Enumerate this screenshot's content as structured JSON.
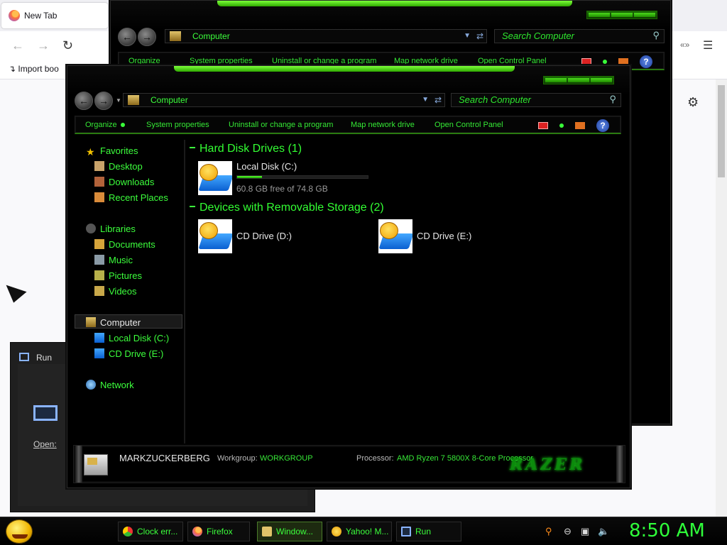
{
  "firefox": {
    "tab_title": "New Tab",
    "import_bookmarks": "Import boo",
    "ext_label": "«»"
  },
  "run_dialog": {
    "title": "Run",
    "open_label": "Open:"
  },
  "explorer_back": {
    "address": "Computer",
    "search_placeholder": "Search Computer",
    "commands": [
      "Organize",
      "System properties",
      "Uninstall or change a program",
      "Map network drive",
      "Open Control Panel"
    ]
  },
  "explorer": {
    "address": "Computer",
    "search_placeholder": "Search Computer",
    "commands": {
      "organize": "Organize",
      "system_properties": "System properties",
      "uninstall": "Uninstall or change a program",
      "map_drive": "Map network drive",
      "control_panel": "Open Control Panel"
    },
    "nav": {
      "favorites": "Favorites",
      "desktop": "Desktop",
      "downloads": "Downloads",
      "recent": "Recent Places",
      "libraries": "Libraries",
      "documents": "Documents",
      "music": "Music",
      "pictures": "Pictures",
      "videos": "Videos",
      "computer": "Computer",
      "local_disk": "Local Disk (C:)",
      "cd_drive": "CD Drive (E:)",
      "network": "Network"
    },
    "groups": {
      "hdd": "Hard Disk Drives (1)",
      "removable": "Devices with Removable Storage (2)"
    },
    "drives": {
      "c_name": "Local Disk (C:)",
      "c_free": "60.8 GB free of 74.8 GB",
      "c_used_fraction": 0.19,
      "d_name": "CD Drive (D:)",
      "e_name": "CD Drive (E:)"
    },
    "details": {
      "computer_name": "MARKZUCKERBERG",
      "workgroup_label": "Workgroup:",
      "workgroup": "WORKGROUP",
      "processor_label": "Processor:",
      "processor": "AMD Ryzen 7 5800X 8-Core Processor",
      "brand": "RAZER"
    }
  },
  "taskbar": {
    "items": [
      "Clock err...",
      "Firefox",
      "Window...",
      "Yahoo! M...",
      "Run"
    ],
    "clock": "8:50 AM"
  },
  "colors": {
    "accent_green": "#3cff3c",
    "window_bg": "#000000"
  }
}
